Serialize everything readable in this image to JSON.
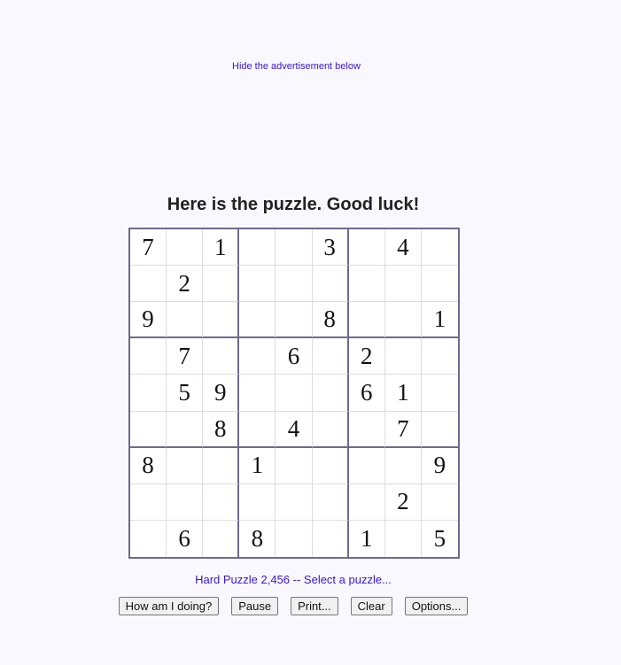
{
  "ad": {
    "hide_link": "Hide the advertisement below"
  },
  "heading": "Here is the puzzle. Good luck!",
  "puzzle": {
    "rows": [
      [
        "7",
        "",
        "1",
        "",
        "",
        "3",
        "",
        "4",
        ""
      ],
      [
        "",
        "2",
        "",
        "",
        "",
        "",
        "",
        "",
        ""
      ],
      [
        "9",
        "",
        "",
        "",
        "",
        "8",
        "",
        "",
        "1"
      ],
      [
        "",
        "7",
        "",
        "",
        "6",
        "",
        "2",
        "",
        ""
      ],
      [
        "",
        "5",
        "9",
        "",
        "",
        "",
        "6",
        "1",
        ""
      ],
      [
        "",
        "",
        "8",
        "",
        "4",
        "",
        "",
        "7",
        ""
      ],
      [
        "8",
        "",
        "",
        "1",
        "",
        "",
        "",
        "",
        "9"
      ],
      [
        "",
        "",
        "",
        "",
        "",
        "",
        "",
        "2",
        ""
      ],
      [
        "",
        "6",
        "",
        "8",
        "",
        "",
        "1",
        "",
        "5"
      ]
    ]
  },
  "puzzle_link": "Hard Puzzle 2,456 -- Select a puzzle...",
  "buttons": {
    "how": "How am I doing?",
    "pause": "Pause",
    "print": "Print...",
    "clear": "Clear",
    "options": "Options..."
  },
  "colors": {
    "link": "#3a14d4",
    "grid_border": "#6e6a8c",
    "background": "#f8f8fe"
  }
}
